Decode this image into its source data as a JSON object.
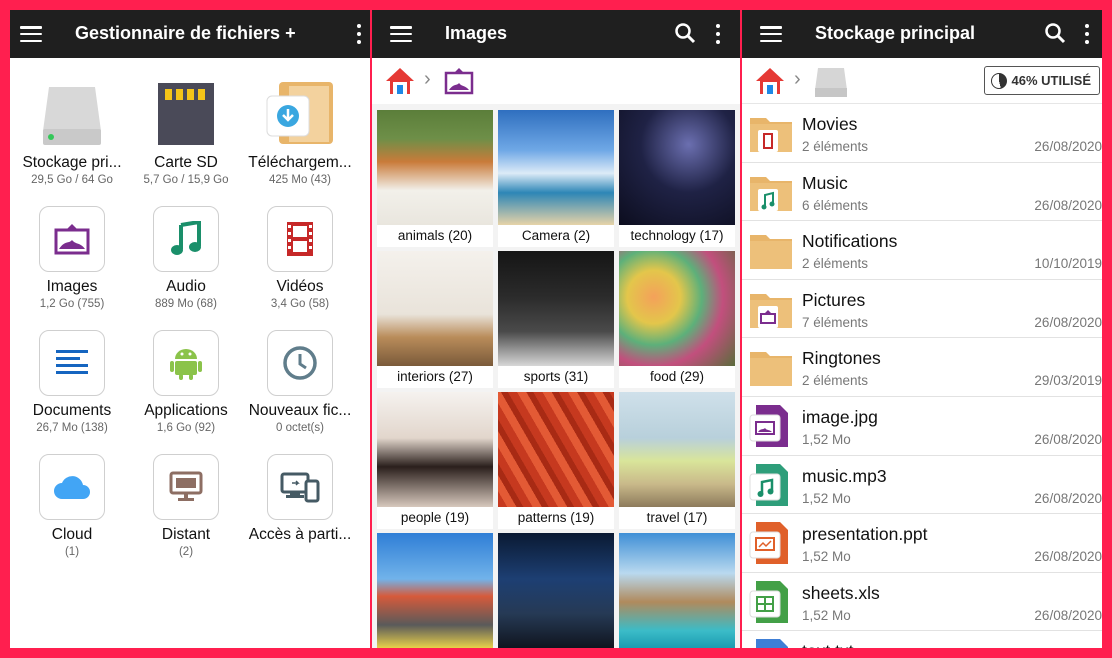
{
  "panel1": {
    "title": "Gestionnaire de fichiers +",
    "tiles": [
      {
        "label": "Stockage pri...",
        "sub": "29,5 Go / 64 Go",
        "icon": "hdd-icon"
      },
      {
        "label": "Carte SD",
        "sub": "5,7 Go / 15,9 Go",
        "icon": "sd-card-icon"
      },
      {
        "label": "Téléchargem...",
        "sub": "425 Mo (43)",
        "icon": "download-folder-icon"
      },
      {
        "label": "Images",
        "sub": "1,2 Go (755)",
        "icon": "image-icon"
      },
      {
        "label": "Audio",
        "sub": "889 Mo (68)",
        "icon": "music-note-icon"
      },
      {
        "label": "Vidéos",
        "sub": "3,4 Go (58)",
        "icon": "film-icon"
      },
      {
        "label": "Documents",
        "sub": "26,7 Mo (138)",
        "icon": "document-lines-icon"
      },
      {
        "label": "Applications",
        "sub": "1,6 Go (92)",
        "icon": "android-icon"
      },
      {
        "label": "Nouveaux fic...",
        "sub": "0 octet(s)",
        "icon": "clock-icon"
      },
      {
        "label": "Cloud",
        "sub": "(1)",
        "icon": "cloud-icon"
      },
      {
        "label": "Distant",
        "sub": "(2)",
        "icon": "monitor-icon"
      },
      {
        "label": "Accès à parti...",
        "sub": "",
        "icon": "devices-icon"
      }
    ]
  },
  "panel2": {
    "title": "Images",
    "albums": [
      {
        "caption": "animals (20)"
      },
      {
        "caption": "Camera (2)"
      },
      {
        "caption": "technology (17)"
      },
      {
        "caption": "interiors (27)"
      },
      {
        "caption": "sports (31)"
      },
      {
        "caption": "food (29)"
      },
      {
        "caption": "people (19)"
      },
      {
        "caption": "patterns (19)"
      },
      {
        "caption": "travel (17)"
      },
      {
        "caption": ""
      },
      {
        "caption": ""
      },
      {
        "caption": ""
      }
    ]
  },
  "panel3": {
    "title": "Stockage principal",
    "usage": "46% UTILISÉ",
    "usage_fraction": 0.46,
    "items": [
      {
        "name": "Movies",
        "meta": "2 éléments",
        "date": "26/08/2020",
        "icon": "folder-film-icon"
      },
      {
        "name": "Music",
        "meta": "6 éléments",
        "date": "26/08/2020",
        "icon": "folder-music-icon"
      },
      {
        "name": "Notifications",
        "meta": "2 éléments",
        "date": "10/10/2019",
        "icon": "folder-icon"
      },
      {
        "name": "Pictures",
        "meta": "7 éléments",
        "date": "26/08/2020",
        "icon": "folder-image-icon"
      },
      {
        "name": "Ringtones",
        "meta": "2 éléments",
        "date": "29/03/2019",
        "icon": "folder-icon"
      },
      {
        "name": "image.jpg",
        "meta": "1,52 Mo",
        "date": "26/08/2020",
        "icon": "image-file-icon"
      },
      {
        "name": "music.mp3",
        "meta": "1,52 Mo",
        "date": "26/08/2020",
        "icon": "audio-file-icon"
      },
      {
        "name": "presentation.ppt",
        "meta": "1,52 Mo",
        "date": "26/08/2020",
        "icon": "presentation-file-icon"
      },
      {
        "name": "sheets.xls",
        "meta": "1,52 Mo",
        "date": "26/08/2020",
        "icon": "spreadsheet-file-icon"
      },
      {
        "name": "text.txt",
        "meta": "",
        "date": "",
        "icon": "text-file-icon"
      }
    ]
  },
  "colors": {
    "frame": "#ff1f4f",
    "topbar": "#1f1f1f",
    "folder": "#e8b56a",
    "image": "#7b2d8e",
    "audio": "#1a8f6a",
    "video": "#c62828",
    "docs": "#1565c0",
    "android": "#8bc34a"
  }
}
